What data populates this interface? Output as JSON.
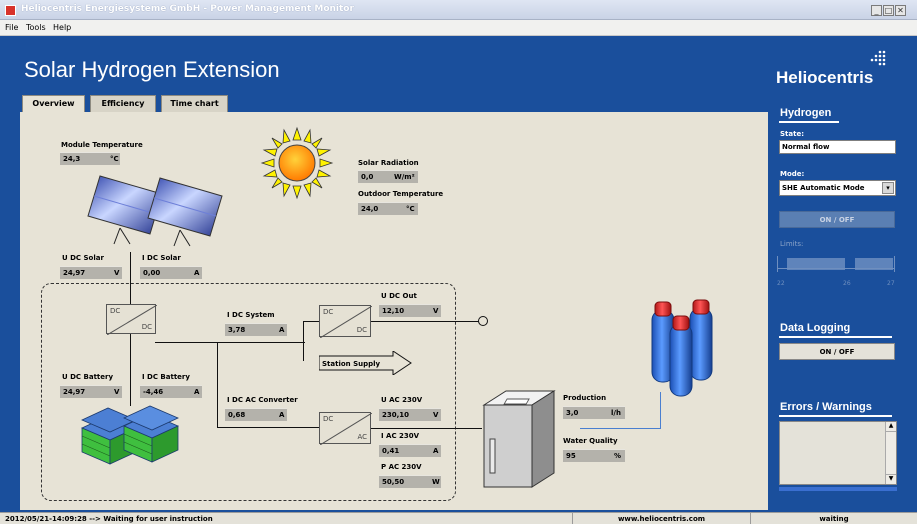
{
  "window": {
    "title": "Heliocentris Energiesysteme GmbH - Power Management Monitor",
    "min": "_",
    "max": "□",
    "close": "✕"
  },
  "menu": [
    "File",
    "Tools",
    "Help"
  ],
  "header": {
    "title": "Solar Hydrogen Extension",
    "brand": "Heliocentris"
  },
  "tabs": [
    "Overview",
    "Efficiency",
    "Time chart"
  ],
  "overview": {
    "module_temperature": {
      "label": "Module Temperature",
      "value": "24,3",
      "unit": "°C"
    },
    "solar_radiation": {
      "label": "Solar Radiation",
      "value": "0,0",
      "unit": "W/m²"
    },
    "outdoor_temperature": {
      "label": "Outdoor Temperature",
      "value": "24,0",
      "unit": "°C"
    },
    "u_dc_solar": {
      "label": "U DC Solar",
      "value": "24,97",
      "unit": "V"
    },
    "i_dc_solar": {
      "label": "I DC Solar",
      "value": "0,00",
      "unit": "A"
    },
    "i_dc_system": {
      "label": "I DC System",
      "value": "3,78",
      "unit": "A"
    },
    "u_dc_out": {
      "label": "U DC Out",
      "value": "12,10",
      "unit": "V"
    },
    "station_supply": "Station Supply",
    "u_dc_battery": {
      "label": "U DC Battery",
      "value": "24,97",
      "unit": "V"
    },
    "i_dc_battery": {
      "label": "I DC Battery",
      "value": "-4,46",
      "unit": "A"
    },
    "i_dc_ac_converter": {
      "label": "I DC AC Converter",
      "value": "0,68",
      "unit": "A"
    },
    "u_ac_230v": {
      "label": "U AC 230V",
      "value": "230,10",
      "unit": "V"
    },
    "i_ac_230v": {
      "label": "I AC 230V",
      "value": "0,41",
      "unit": "A"
    },
    "p_ac_230v": {
      "label": "P AC 230V",
      "value": "50,50",
      "unit": "W"
    },
    "production": {
      "label": "Production",
      "value": "3,0",
      "unit": "l/h"
    },
    "water_quality": {
      "label": "Water Quality",
      "value": "95",
      "unit": "%"
    },
    "converter_dc": "DC",
    "converter_ac": "AC"
  },
  "sidebar": {
    "hydrogen_heading": "Hydrogen",
    "state_label": "State:",
    "state_value": "Normal flow",
    "mode_label": "Mode:",
    "mode_value": "SHE Automatic Mode",
    "onoff_label": "ON / OFF",
    "limits_label": "Limits:",
    "limit_ticks": [
      "22",
      "26",
      "27"
    ],
    "logging_heading": "Data Logging",
    "logging_button": "ON / OFF",
    "errors_heading": "Errors / Warnings"
  },
  "status": {
    "message": "2012/05/21-14:09:28   --> Waiting for user instruction",
    "website": "www.heliocentris.com",
    "state": "waiting"
  },
  "colors": {
    "blue_background": "#1a4f9c",
    "panel": "#e7e3d6",
    "accent_green": "#3fbf3f",
    "cylinder_red": "#e03030",
    "cylinder_blue": "#2a6fd6"
  }
}
